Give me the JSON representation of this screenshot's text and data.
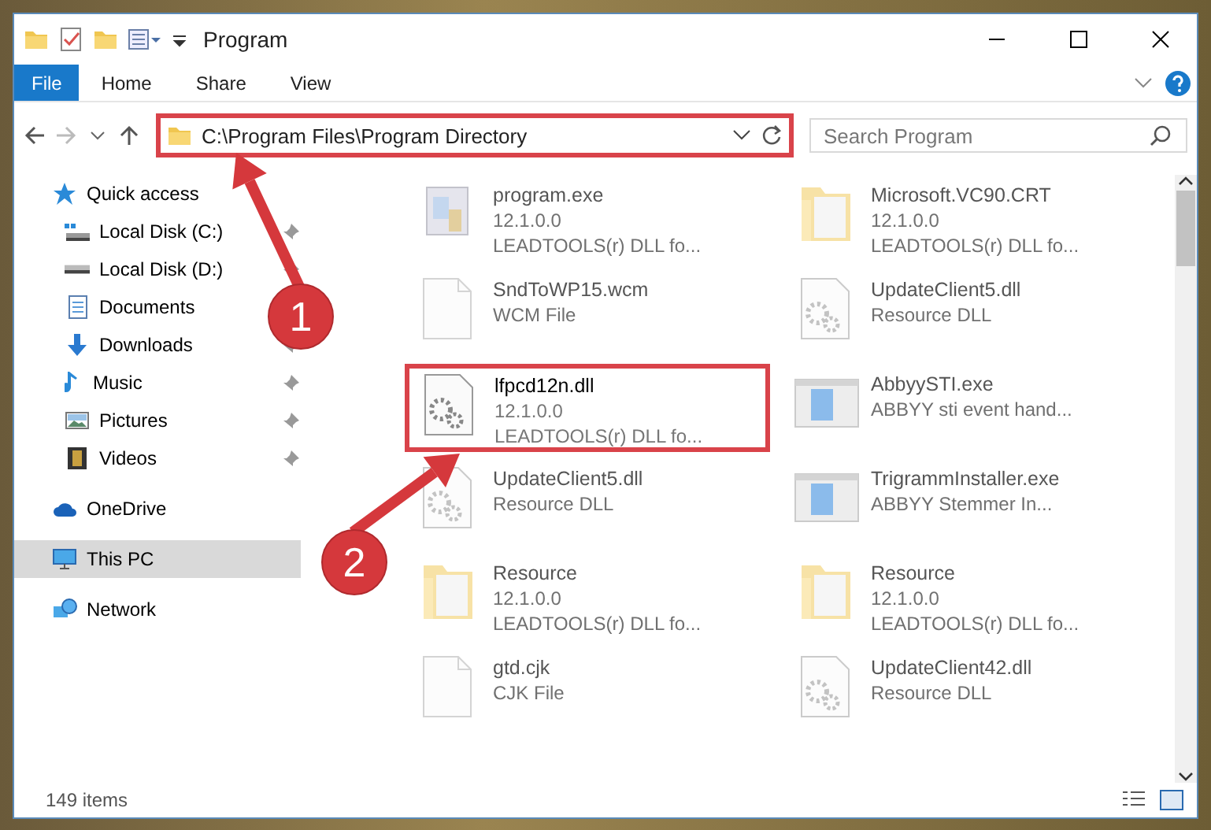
{
  "window": {
    "title": "Program"
  },
  "ribbon_tabs": [
    {
      "label": "File",
      "selected": true
    },
    {
      "label": "Home",
      "selected": false
    },
    {
      "label": "Share",
      "selected": false
    },
    {
      "label": "View",
      "selected": false
    }
  ],
  "address_bar": {
    "path": "C:\\Program Files\\Program Directory",
    "highlighted": true
  },
  "search": {
    "placeholder": "Search Program"
  },
  "sidebar": {
    "items": [
      {
        "label": "Quick access",
        "selected": false,
        "children": [
          {
            "label": "Local Disk (C:)",
            "pinned": true,
            "selected": false
          },
          {
            "label": "Local Disk (D:)",
            "pinned": true,
            "selected": false
          },
          {
            "label": "Documents",
            "selected": false
          },
          {
            "label": "Downloads",
            "pinned": true,
            "selected": false
          },
          {
            "label": "Music",
            "pinned": true,
            "selected": false
          },
          {
            "label": "Pictures",
            "pinned": true,
            "selected": false
          },
          {
            "label": "Videos",
            "pinned": true,
            "selected": false
          }
        ]
      },
      {
        "label": "OneDrive",
        "selected": false
      },
      {
        "label": "This PC",
        "selected": true
      },
      {
        "label": "Network",
        "selected": false
      }
    ]
  },
  "files": [
    {
      "kind": "program",
      "name": "program.exe",
      "lines": [
        "12.1.0.0",
        "LEADTOOLS(r) DLL fo..."
      ],
      "highlighted": false
    },
    {
      "kind": "folder",
      "name": "Microsoft.VC90.CRT",
      "lines": [
        "12.1.0.0",
        "LEADTOOLS(r) DLL fo..."
      ],
      "highlighted": false
    },
    {
      "kind": "blank",
      "name": "SndToWP15.wcm",
      "lines": [
        "WCM File"
      ],
      "highlighted": false
    },
    {
      "kind": "gear",
      "name": "UpdateClient5.dll",
      "lines": [
        "Resource DLL"
      ],
      "highlighted": false
    },
    {
      "kind": "gear",
      "name": "lfpcd12n.dll",
      "lines": [
        "12.1.0.0",
        "LEADTOOLS(r) DLL fo..."
      ],
      "highlighted": true
    },
    {
      "kind": "app",
      "name": "AbbyySTI.exe",
      "lines": [
        "ABBYY sti event hand..."
      ],
      "highlighted": false
    },
    {
      "kind": "gear",
      "name": "UpdateClient5.dll",
      "lines": [
        "Resource DLL"
      ],
      "highlighted": false
    },
    {
      "kind": "app",
      "name": "TrigrammInstaller.exe",
      "lines": [
        "ABBYY Stemmer In..."
      ],
      "highlighted": false
    },
    {
      "kind": "folder",
      "name": "Resource",
      "lines": [
        "12.1.0.0",
        "LEADTOOLS(r) DLL fo..."
      ],
      "highlighted": false
    },
    {
      "kind": "folder",
      "name": "Resource",
      "lines": [
        "12.1.0.0",
        "LEADTOOLS(r) DLL fo..."
      ],
      "highlighted": false
    },
    {
      "kind": "blank",
      "name": "gtd.cjk",
      "lines": [
        "CJK File"
      ],
      "highlighted": false
    },
    {
      "kind": "gear",
      "name": "UpdateClient42.dll",
      "lines": [
        "Resource DLL"
      ],
      "highlighted": false
    }
  ],
  "status_bar": {
    "item_count": "149 items"
  },
  "callouts": [
    {
      "label": "1"
    },
    {
      "label": "2"
    }
  ]
}
